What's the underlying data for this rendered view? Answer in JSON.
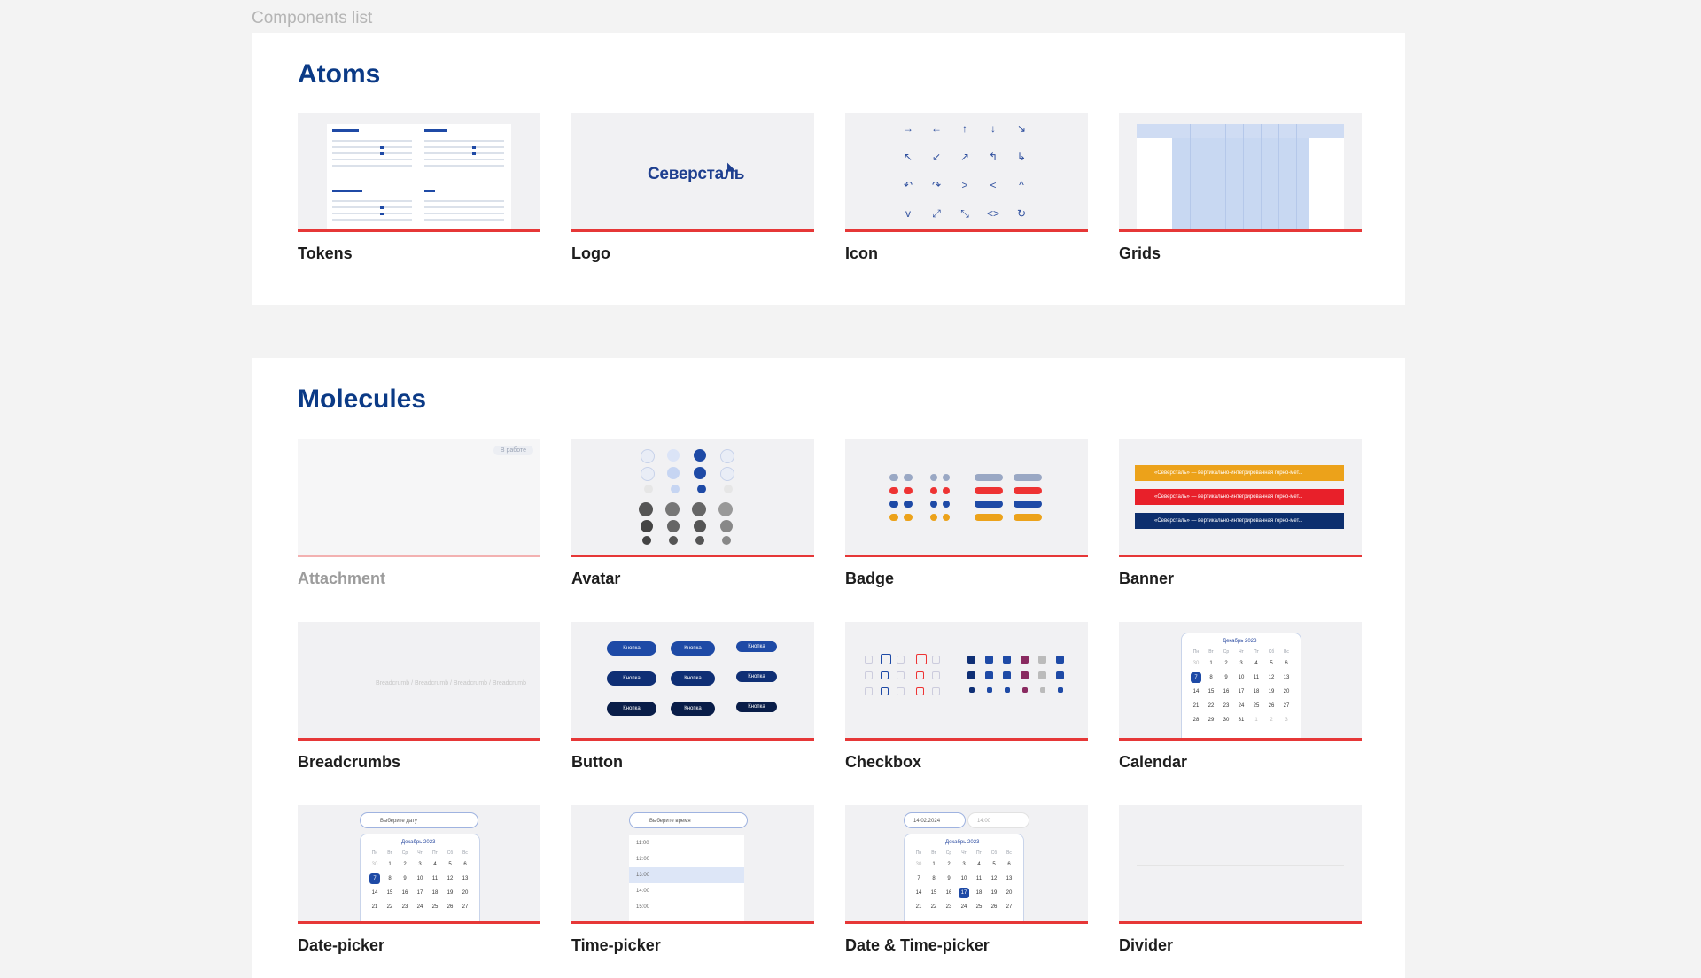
{
  "page": {
    "label": "Components list"
  },
  "atoms": {
    "title": "Atoms",
    "cards": [
      "Tokens",
      "Logo",
      "Icon",
      "Grids"
    ],
    "tokens_preview": {
      "headers": [
        "Blue Primary",
        "Blue Select",
        "Blue Stranger",
        "Grey"
      ]
    },
    "logo_preview": {
      "text": "Северсталь"
    },
    "icon_preview": {
      "glyphs": [
        "→",
        "←",
        "↑",
        "↓",
        "↘",
        "↖",
        "↙",
        "↗",
        "↰",
        "↳",
        "↶",
        "↷",
        ">",
        "<",
        "^",
        "v",
        "⤢",
        "⤡",
        "<>",
        "↻"
      ]
    }
  },
  "molecules": {
    "title": "Molecules",
    "cards": [
      "Attachment",
      "Avatar",
      "Badge",
      "Banner",
      "Breadcrumbs",
      "Button",
      "Checkbox",
      "Calendar",
      "Date-picker",
      "Time-picker",
      "Date & Time-picker",
      "Divider"
    ],
    "attachment_preview": {
      "chip": "В работе"
    },
    "breadcrumbs_preview": {
      "text": "Breadcrumb / Breadcrumb / Breadcrumb / Breadcrumb"
    },
    "banner_preview": {
      "text": "«Северсталь» — вертикально-интегрированная горно-мет..."
    },
    "button_preview": {
      "labels": [
        "Кнопка",
        "Кнопка",
        "Кнопка"
      ]
    },
    "calendar_preview": {
      "month": "Декабрь 2023",
      "weekdays": [
        "Пн",
        "Вт",
        "Ср",
        "Чт",
        "Пт",
        "Сб",
        "Вс"
      ],
      "days": [
        "30",
        "1",
        "2",
        "3",
        "4",
        "5",
        "6",
        "7",
        "8",
        "9",
        "10",
        "11",
        "12",
        "13",
        "14",
        "15",
        "16",
        "17",
        "18",
        "19",
        "20",
        "21",
        "22",
        "23",
        "24",
        "25",
        "26",
        "27",
        "28",
        "29",
        "30",
        "31",
        "1",
        "2",
        "3"
      ]
    },
    "datepicker_preview": {
      "placeholder": "Выберите дату",
      "month": "Декабрь 2023"
    },
    "timepicker_preview": {
      "placeholder": "Выберите время",
      "times": [
        "11:00",
        "12:00",
        "13:00",
        "14:00",
        "15:00"
      ]
    },
    "datetimepicker_preview": {
      "date": "14.02.2024",
      "time": "14:00",
      "month": "Декабрь 2023"
    }
  },
  "colors": {
    "accent_red": "#e63737",
    "brand_blue": "#0b3a86",
    "grid_blue": "#c8d8f2"
  }
}
